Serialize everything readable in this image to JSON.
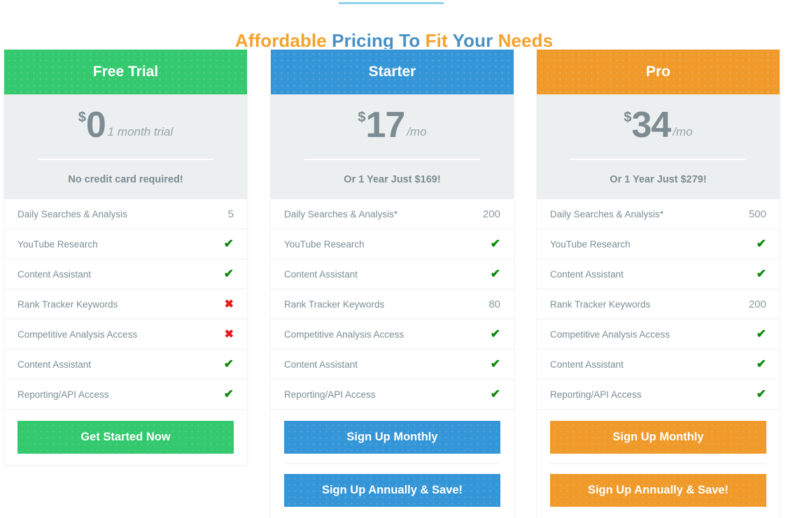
{
  "heading": {
    "part1": "Affordable ",
    "part2": "Pricing To ",
    "part3": "Fit ",
    "part4": "Your ",
    "part5": "Needs",
    "rule_color": "#8ed2f0",
    "orange": "#f5a22d",
    "blue": "#4a90c4"
  },
  "icons": {
    "check": "✔",
    "cross": "✖"
  },
  "plans": [
    {
      "name": "Free Trial",
      "accent": "#34c96e",
      "currency": "$",
      "amount": "0",
      "period": "1 month trial",
      "note": "No credit card required!",
      "features": [
        {
          "label": "Daily Searches & Analysis",
          "value": "5",
          "kind": "text"
        },
        {
          "label": "YouTube Research",
          "value": "✔",
          "kind": "yes"
        },
        {
          "label": "Content Assistant",
          "value": "✔",
          "kind": "yes"
        },
        {
          "label": "Rank Tracker Keywords",
          "value": "✖",
          "kind": "no"
        },
        {
          "label": "Competitive Analysis Access",
          "value": "✖",
          "kind": "no"
        },
        {
          "label": "Content Assistant",
          "value": "✔",
          "kind": "yes"
        },
        {
          "label": "Reporting/API Access",
          "value": "✔",
          "kind": "yes"
        }
      ],
      "buttons": [
        {
          "label": "Get Started Now",
          "name": "get-started-now-button"
        }
      ]
    },
    {
      "name": "Starter",
      "accent": "#3596d7",
      "currency": "$",
      "amount": "17",
      "period": "/mo",
      "note": "Or 1 Year Just $169!",
      "features": [
        {
          "label": "Daily Searches & Analysis*",
          "value": "200",
          "kind": "text"
        },
        {
          "label": "YouTube Research",
          "value": "✔",
          "kind": "yes"
        },
        {
          "label": "Content Assistant",
          "value": "✔",
          "kind": "yes"
        },
        {
          "label": "Rank Tracker Keywords",
          "value": "80",
          "kind": "text"
        },
        {
          "label": "Competitive Analysis Access",
          "value": "✔",
          "kind": "yes"
        },
        {
          "label": "Content Assistant",
          "value": "✔",
          "kind": "yes"
        },
        {
          "label": "Reporting/API Access",
          "value": "✔",
          "kind": "yes"
        }
      ],
      "buttons": [
        {
          "label": "Sign Up Monthly",
          "name": "sign-up-monthly-button"
        },
        {
          "label": "Sign Up Annually & Save!",
          "name": "sign-up-annually-button"
        }
      ]
    },
    {
      "name": "Pro",
      "accent": "#ef9a2a",
      "currency": "$",
      "amount": "34",
      "period": "/mo",
      "note": "Or 1 Year Just $279!",
      "features": [
        {
          "label": "Daily Searches & Analysis*",
          "value": "500",
          "kind": "text"
        },
        {
          "label": "YouTube Research",
          "value": "✔",
          "kind": "yes"
        },
        {
          "label": "Content Assistant",
          "value": "✔",
          "kind": "yes"
        },
        {
          "label": "Rank Tracker Keywords",
          "value": "200",
          "kind": "text"
        },
        {
          "label": "Competitive Analysis Access",
          "value": "✔",
          "kind": "yes"
        },
        {
          "label": "Content Assistant",
          "value": "✔",
          "kind": "yes"
        },
        {
          "label": "Reporting/API Access",
          "value": "✔",
          "kind": "yes"
        }
      ],
      "buttons": [
        {
          "label": "Sign Up Monthly",
          "name": "sign-up-monthly-button"
        },
        {
          "label": "Sign Up Annually & Save!",
          "name": "sign-up-annually-button"
        }
      ]
    }
  ]
}
